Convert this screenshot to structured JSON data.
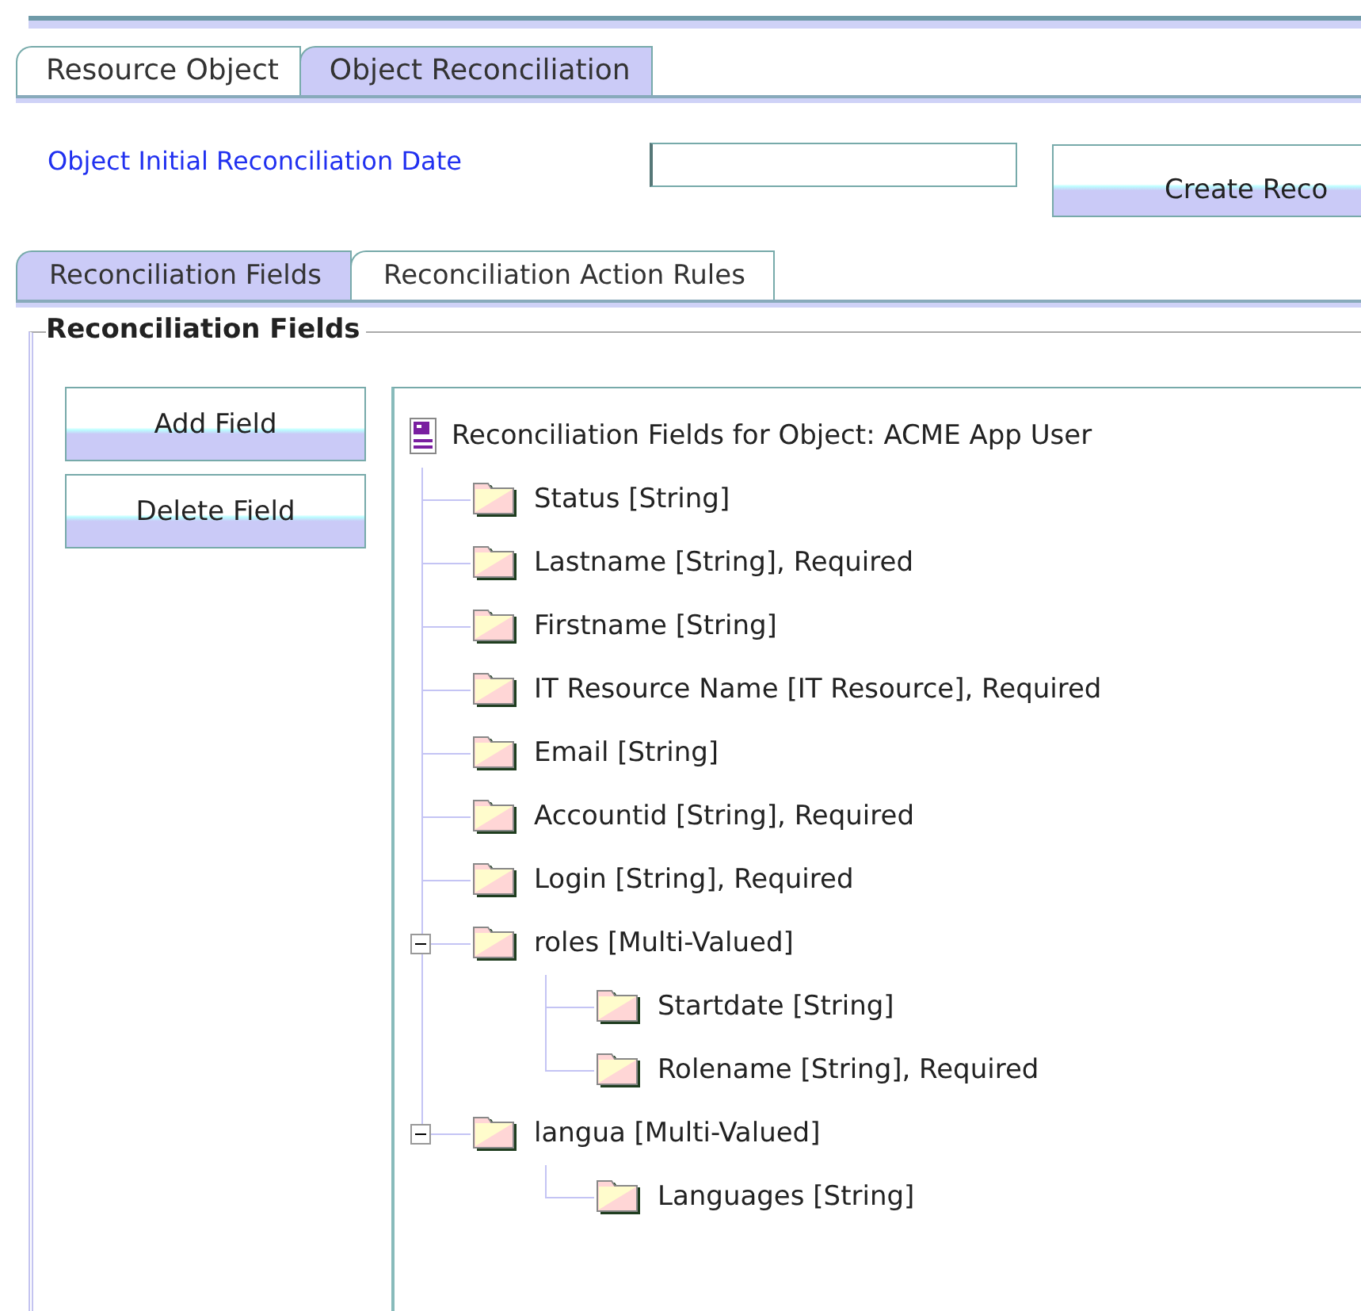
{
  "tabs": [
    {
      "label": "Resource Object",
      "selected": false
    },
    {
      "label": "Object Reconciliation",
      "selected": true
    }
  ],
  "date_field": {
    "label": "Object Initial Reconciliation Date"
  },
  "create_button": "Create Reco",
  "subtabs": [
    {
      "label": "Reconciliation Fields",
      "selected": true
    },
    {
      "label": "Reconciliation Action Rules",
      "selected": false
    }
  ],
  "group_title": "Reconciliation Fields",
  "buttons": [
    "Add Field",
    "Delete Field"
  ],
  "tree": {
    "label": "Reconciliation Fields for Object: ACME App User",
    "children": [
      {
        "label": "Status [String]"
      },
      {
        "label": "Lastname [String], Required"
      },
      {
        "label": "Firstname [String]"
      },
      {
        "label": "IT Resource Name [IT Resource], Required"
      },
      {
        "label": "Email [String]"
      },
      {
        "label": "Accountid [String], Required"
      },
      {
        "label": "Login [String], Required"
      },
      {
        "label": "roles [Multi-Valued]",
        "expanded": true,
        "children": [
          {
            "label": "Startdate [String]"
          },
          {
            "label": "Rolename [String], Required"
          }
        ]
      },
      {
        "label": "langua [Multi-Valued]",
        "expanded": true,
        "children": [
          {
            "label": "Languages [String]"
          }
        ]
      }
    ]
  }
}
